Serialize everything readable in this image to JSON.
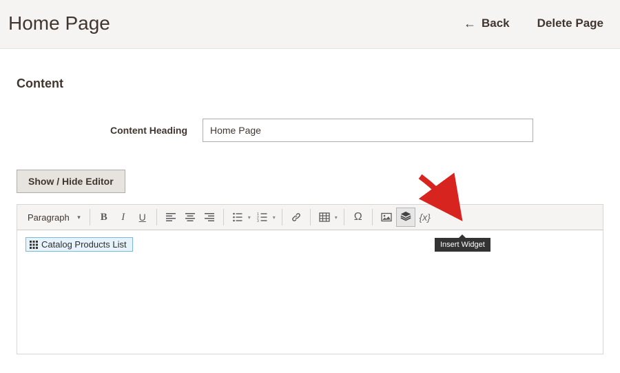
{
  "header": {
    "title": "Home Page",
    "back_label": "Back",
    "delete_label": "Delete Page"
  },
  "section": {
    "title": "Content"
  },
  "field": {
    "label": "Content Heading",
    "value": "Home Page"
  },
  "buttons": {
    "toggle_editor": "Show / Hide Editor"
  },
  "toolbar": {
    "format_select": "Paragraph",
    "insert_variable_glyph": "{x}"
  },
  "tooltip": {
    "insert_widget": "Insert Widget"
  },
  "editor": {
    "widget_chip": "Catalog Products List"
  },
  "colors": {
    "chip_bg": "#e7f3fb",
    "chip_border": "#7ab8dc",
    "toolbar_bg": "#f5f4f2",
    "text": "#41362f"
  }
}
